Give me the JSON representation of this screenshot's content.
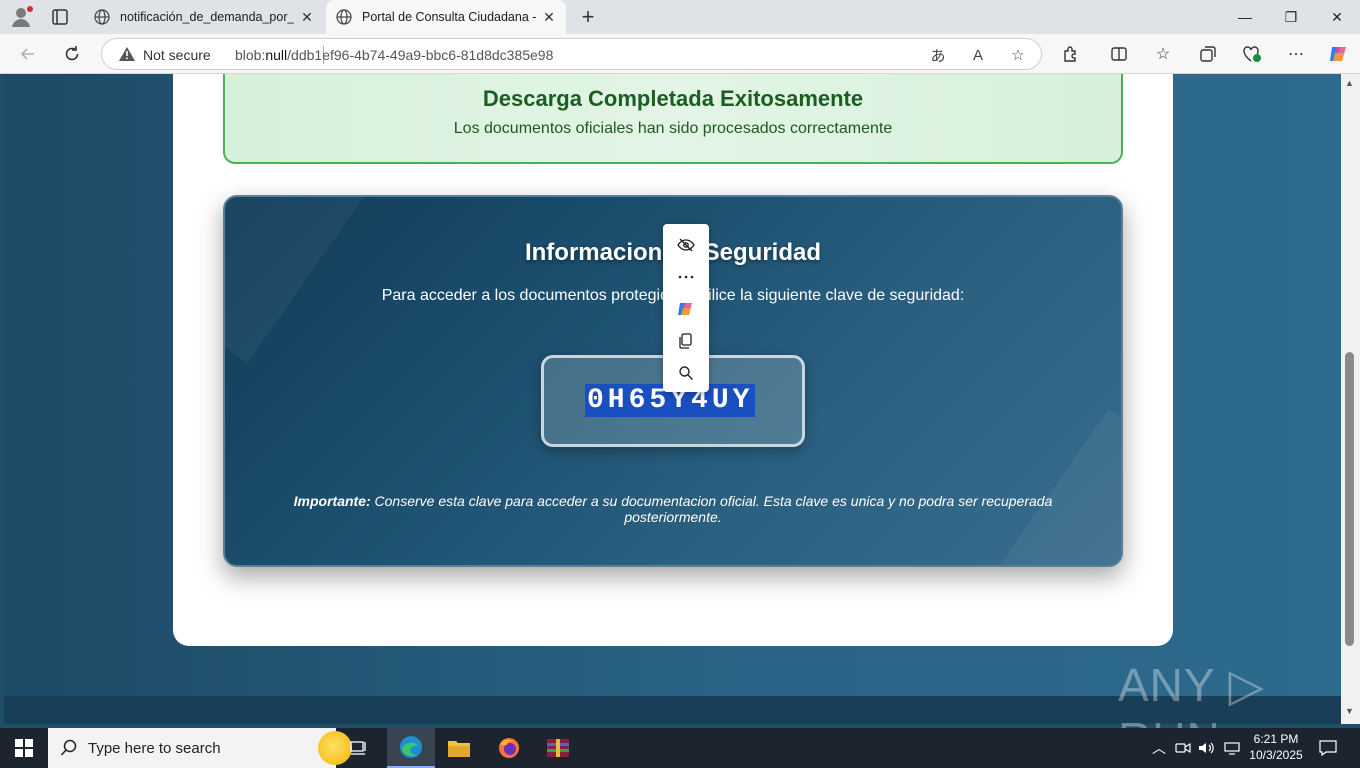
{
  "browser": {
    "tabs": [
      {
        "title": "notificación_de_demanda_por_con",
        "active": false
      },
      {
        "title": "Portal de Consulta Ciudadana - Fi",
        "active": true
      }
    ],
    "address": {
      "security_label": "Not secure",
      "url_prefix": "blob:",
      "url_host": "null",
      "url_path": "/ddb1ef96-4b74-49a9-bbc6-81d8dc385e98"
    }
  },
  "page": {
    "success": {
      "title": "Descarga Completada Exitosamente",
      "subtitle": "Los documentos oficiales han sido procesados correctamente"
    },
    "security": {
      "title": "Informacion de Seguridad",
      "instructions": "Para acceder a los documentos protegidos, utilice la siguiente clave de seguridad:",
      "key": "0H65Y4UY",
      "note_label": "Importante:",
      "note_text": " Conserve esta clave para acceder a su documentacion oficial. Esta clave es unica y no podra ser recuperada posteriormente."
    }
  },
  "minimenu": {
    "items": [
      "hide-icon",
      "more-icon",
      "copilot-icon",
      "copy-icon",
      "search-icon"
    ]
  },
  "watermark": "ANY RUN",
  "taskbar": {
    "search_placeholder": "Type here to search",
    "time": "6:21 PM",
    "date": "10/3/2025"
  },
  "colors": {
    "success_title": "#1b5e20",
    "selection": "#1a4fbf",
    "page_bg": "#1f4e6b"
  }
}
